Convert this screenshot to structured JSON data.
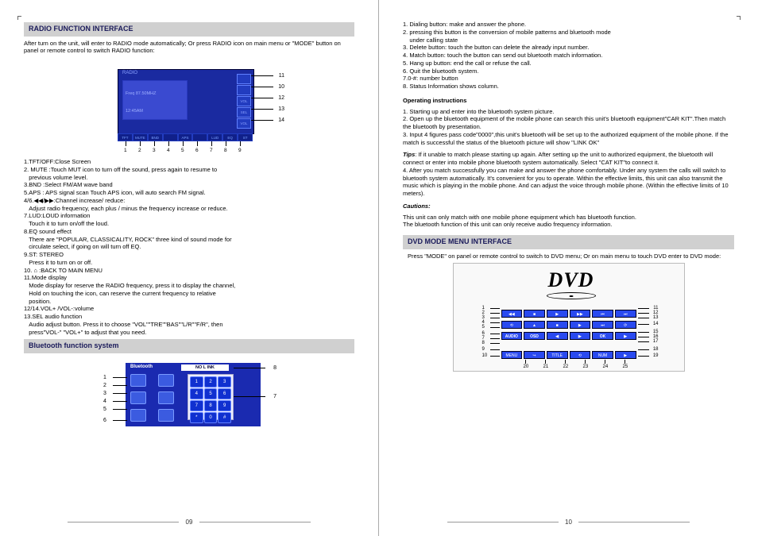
{
  "left": {
    "section1_title": "RADIO FUNCTION INTERFACE",
    "intro": "After turn on the unit, will enter to RADIO mode automatically; Or press RADIO icon on main menu or \"MODE\" button on panel or remote control to switch RADIO function:",
    "radio": {
      "label": "RADIO",
      "freq_label": "Freq\n87.50MHZ",
      "time": "12:45AM",
      "right_buttons": [
        "",
        "",
        "VOL",
        "SEL",
        "VOL"
      ],
      "bottom_buttons": [
        "TFT",
        "MUTE",
        "BND",
        "",
        "APS",
        "",
        "LUD",
        "EQ",
        "ST"
      ],
      "callouts_right": [
        "11",
        "10",
        "12",
        "13",
        "14"
      ],
      "callouts_bottom": [
        "1",
        "2",
        "3",
        "4",
        "5",
        "6",
        "7",
        "8",
        "9"
      ]
    },
    "radio_list": [
      "1.TFT/OFF:Close Screen",
      "2. MUTE :Touch MUT icon to turn off the sound, press again to resume to",
      "   previous volume level.",
      "3.BND :Select FM/AM wave band",
      "5.APS : APS signal scan Touch APS icon, will auto search FM signal.",
      "4/6.◀◀/▶▶:Channel increase/ reduce:",
      "   Adjust radio frequency, each plus / minus the frequency increase or reduce.",
      "7.LUD:LOUD information",
      "   Touch it to turn on/off the loud.",
      "8.EQ sound effect",
      "   There are \"POPULAR, CLASSICALITY, ROCK\" three kind of sound mode for",
      "   circulate select, if going on will turn off EQ.",
      "9.ST: STEREO",
      "   Press it to turn on or off.",
      "10. ⌂ :BACK TO MAIN MENU",
      "11.Mode display",
      "   Mode display for reserve the RADIO frequency, press it to display the channel,",
      "   Hold on touching the icon, can reserve the current frequency to relative",
      "   position.",
      "12/14.VOL+ /VOL-:volume",
      "13.SEL audio function",
      "   Audio adjust button. Press it to choose \"VOL\"\"TRE\"\"BAS\"\"L/R\"\"F/R\", then",
      "   press\"VOL-\" \"VOL+\" to adjust that you need."
    ],
    "section2_title": "Bluetooth function system",
    "bluetooth": {
      "title": "Bluetooth",
      "nolink": "NO L INK",
      "keypad": [
        "1",
        "2",
        "3",
        "4",
        "5",
        "6",
        "7",
        "8",
        "9",
        "*",
        "0",
        "#"
      ],
      "callouts_left": [
        "1",
        "2",
        "3",
        "4",
        "5",
        "6"
      ],
      "callouts_right": [
        "8",
        "7"
      ]
    },
    "page_num": "09"
  },
  "right": {
    "bt_list": [
      "1. Dialing button: make and answer the phone.",
      "2. pressing this button is the conversion of mobile patterns and bluetooth mode",
      "    under calling state",
      "3. Delete button: touch the button can delete the already input number.",
      "4. Match button: touch the button can send out bluetooth match information.",
      "5. Hang up button: end the call or refuse the call.",
      "6. Quit the bluetooth system.",
      "7.0-#: number button",
      "8. Status Information shows column."
    ],
    "op_title": "Operating instructions",
    "op_list": [
      "1. Starting up and enter into the bluetooth system picture.",
      "2. Open up the bluetooth equipment of the mobile phone can search this unit's bluetooth equipment\"CAR KIT\".Then match the bluetooth by presentation.",
      "3. Input 4 figures pass code\"0000\",this unit's bluetooth will be set up to the authorized equipment of the mobile phone. If the match is successful the status of the bluetooth picture will show \"LINK OK\""
    ],
    "tips_label": "Tips",
    "tips_text": ": If it unable to match please starting up again. After setting up the unit to authorized equipment, the bluetooth will connect or enter into mobile phone bluetooth system automatically. Select \"CAT KIT\"to connect it.\n4. After you match successfully you can make and answer the phone comfortably. Under any system the calls will switch to bluetooth system automatically. It's convenient for you to operate. Within the effective limits, this unit can also transmit the music which is playing in the mobile phone. And can adjust the voice through mobile phone. (Within the effective limits of 10 meters).",
    "cautions_label": "Cautions:",
    "cautions_text": "This unit can only match with one mobile phone equipment which has bluetooth function.\nThe bluetooth function of this unit can only receive audio frequency information.",
    "dvd_title": "DVD MODE MENU INTERFACE",
    "dvd_intro": "Press \"MODE\" on panel or remote control to switch to DVD menu; Or on main menu to touch DVD enter to DVD mode:",
    "dvd": {
      "logo": "DVD",
      "row_c": [
        "AUDIO",
        "OSD",
        "◀",
        "▶",
        "OK",
        "▶"
      ],
      "row_d": [
        "MENU",
        "↪",
        "TITLE",
        "⟲",
        "NUM",
        "▶"
      ],
      "callouts_left": [
        "1",
        "2",
        "3",
        "4",
        "5",
        "6",
        "7",
        "8",
        "9",
        "10"
      ],
      "callouts_right": [
        "11",
        "12",
        "13",
        "14",
        "15",
        "16",
        "17",
        "18",
        "19"
      ],
      "callouts_bottom": [
        "20",
        "21",
        "22",
        "23",
        "24",
        "25"
      ]
    },
    "page_num": "10"
  }
}
